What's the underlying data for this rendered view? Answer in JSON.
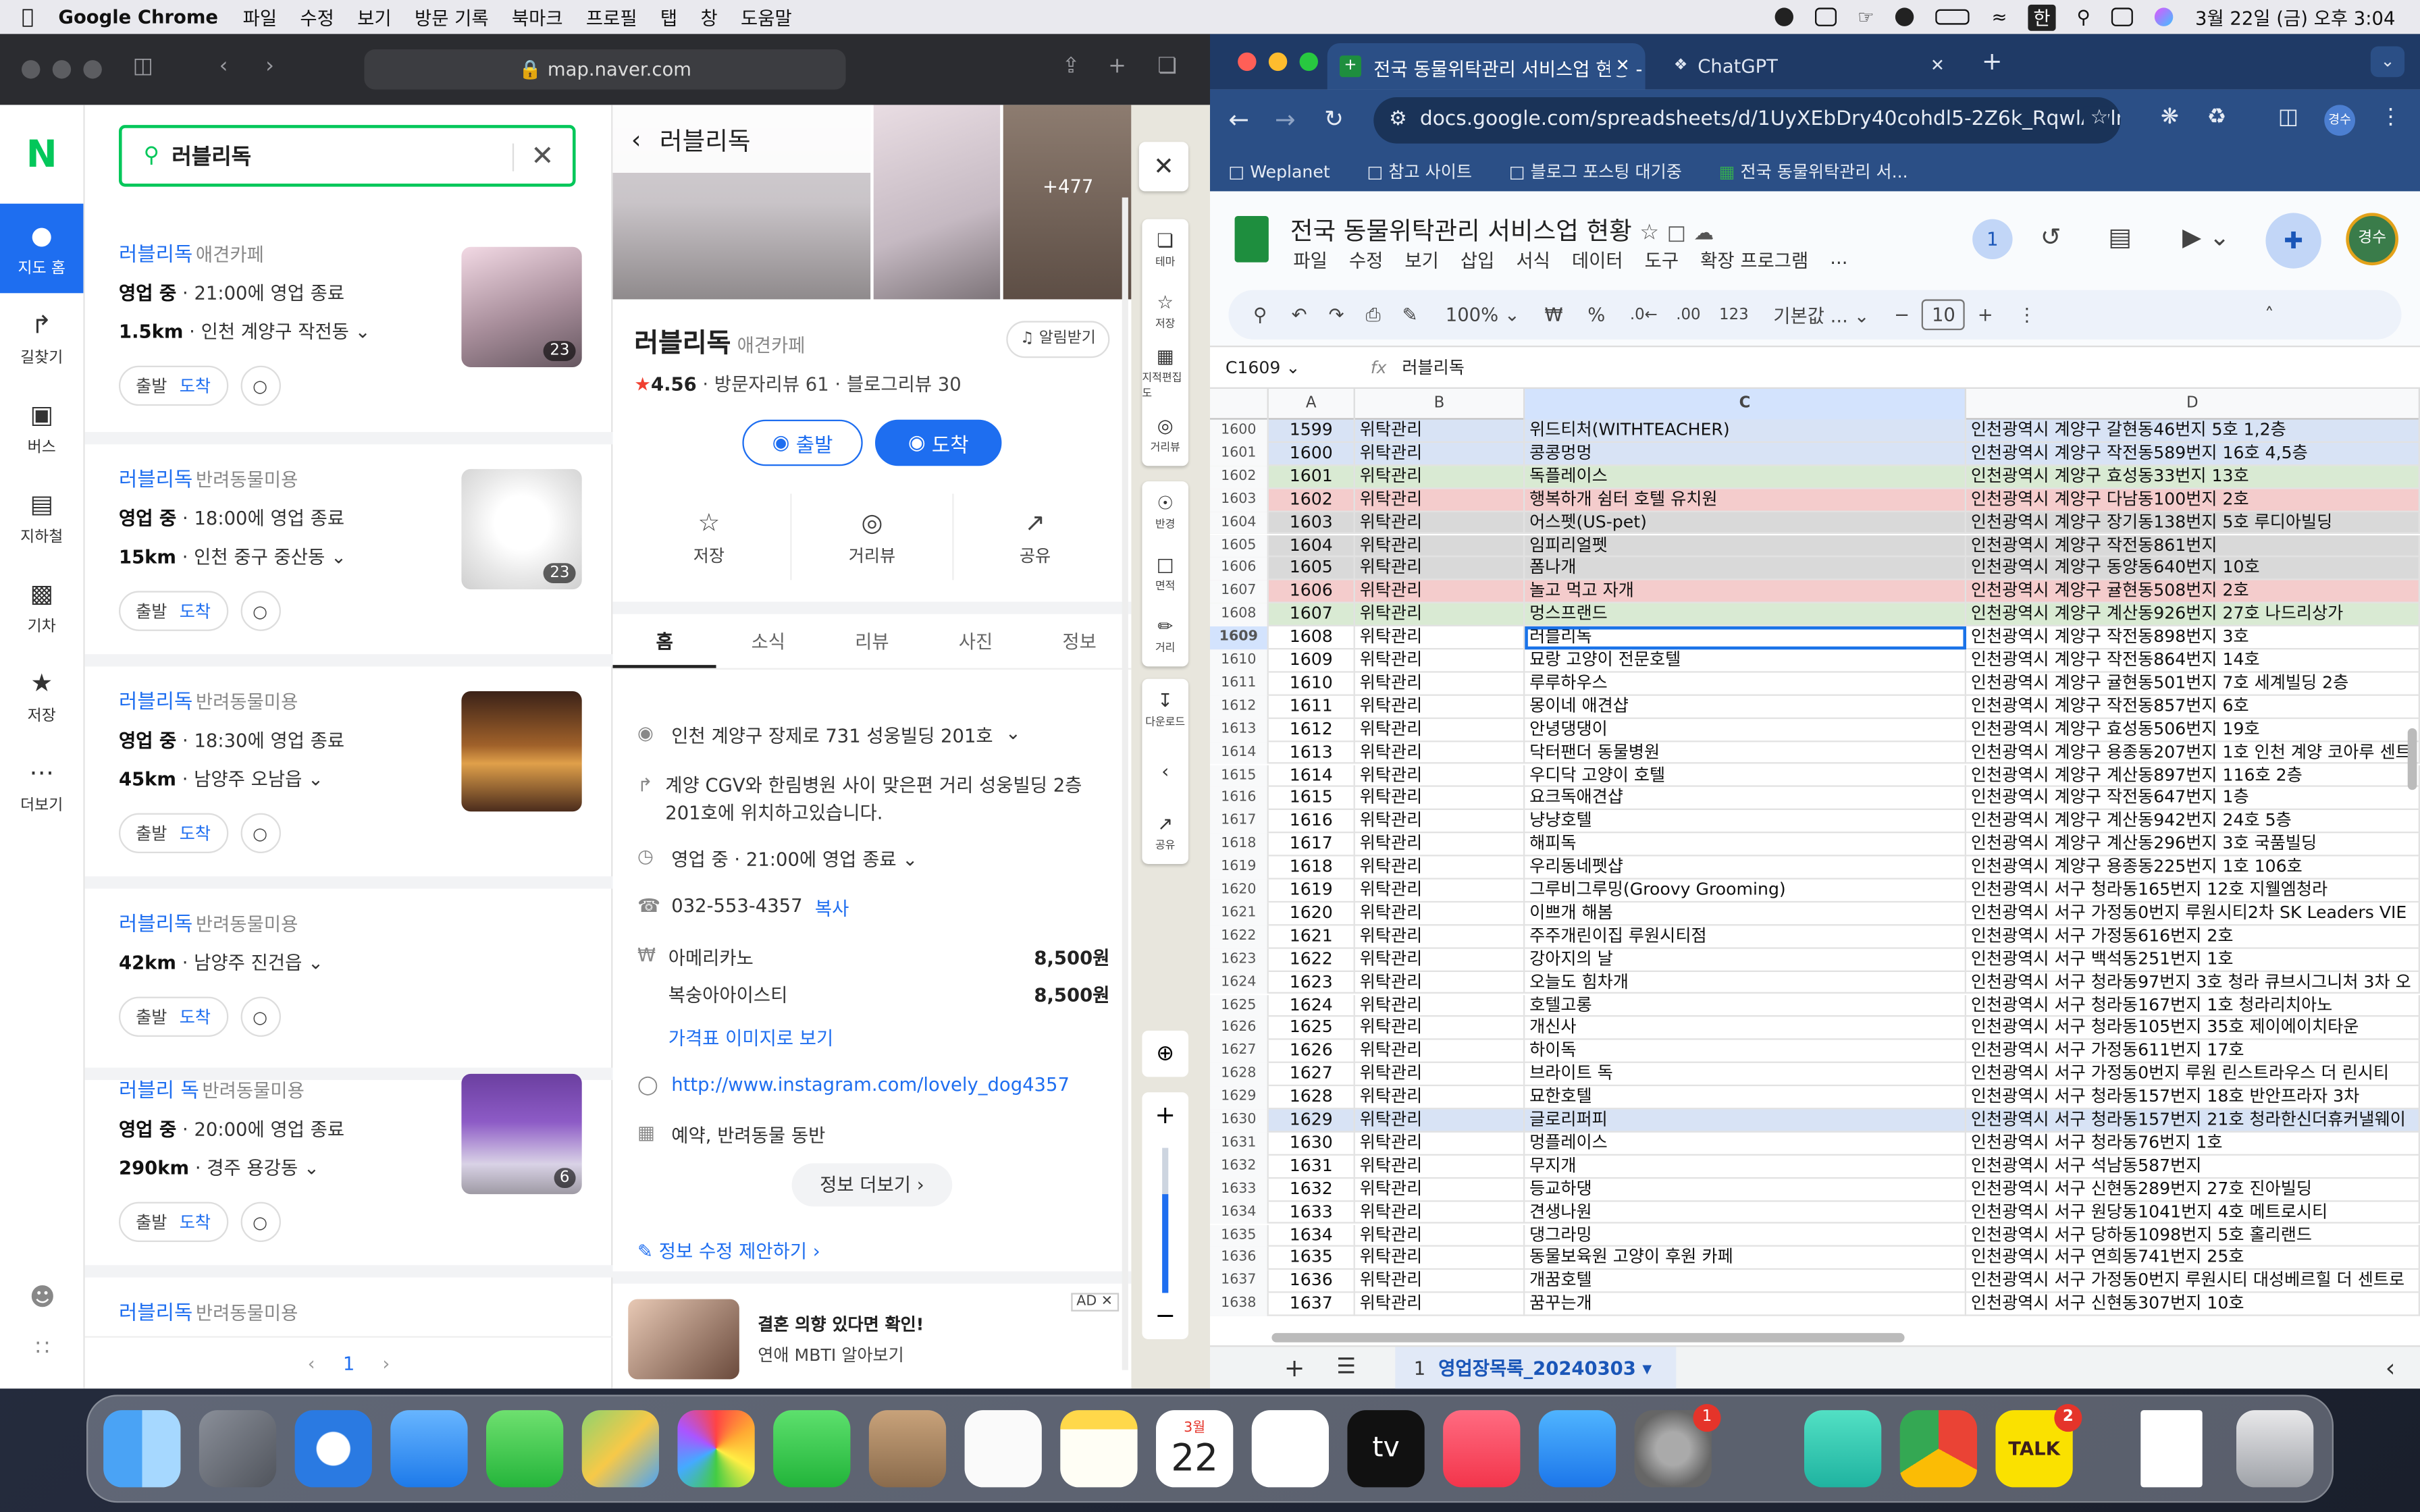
{
  "menubar": {
    "app_name": "Google Chrome",
    "items": [
      "파일",
      "수정",
      "보기",
      "방문 기록",
      "북마크",
      "프로필",
      "탭",
      "창",
      "도움말"
    ],
    "ime": "한",
    "datetime": "3월 22일 (금) 오후 3:04"
  },
  "naver": {
    "url": "map.naver.com",
    "logo": "N",
    "rail": [
      {
        "label": "지도 홈",
        "icon": "map-pin-icon"
      },
      {
        "label": "길찾기",
        "icon": "directions-icon"
      },
      {
        "label": "버스",
        "icon": "bus-icon"
      },
      {
        "label": "지하철",
        "icon": "subway-icon"
      },
      {
        "label": "기차",
        "icon": "train-icon"
      },
      {
        "label": "저장",
        "icon": "star-icon"
      },
      {
        "label": "더보기",
        "icon": "more-icon"
      }
    ],
    "search_value": "러블리독",
    "results": [
      {
        "name": "러블리독",
        "category": "애견카페",
        "status": "영업 중",
        "hours": "21:00에 영업 종료",
        "distance": "1.5km",
        "area": "인천 계양구 작전동",
        "photos": "23"
      },
      {
        "name": "러블리독",
        "category": "반려동물미용",
        "status": "영업 중",
        "hours": "18:00에 영업 종료",
        "distance": "15km",
        "area": "인천 중구 중산동",
        "photos": "23"
      },
      {
        "name": "러블리독",
        "category": "반려동물미용",
        "status": "영업 중",
        "hours": "18:30에 영업 종료",
        "distance": "45km",
        "area": "남양주 오남읍",
        "photos": ""
      },
      {
        "name": "러블리독",
        "category": "반려동물미용",
        "status": "",
        "hours": "",
        "distance": "42km",
        "area": "남양주 진건읍",
        "photos": ""
      },
      {
        "name": "러블리 독",
        "category": "반려동물미용",
        "status": "영업 중",
        "hours": "20:00에 영업 종료",
        "distance": "290km",
        "area": "경주 용강동",
        "photos": "6"
      },
      {
        "name": "러블리독",
        "category": "반려동물미용",
        "status": "",
        "hours": "",
        "distance": "",
        "area": "",
        "photos": ""
      }
    ],
    "btn_depart": "출발",
    "btn_arrive": "도착",
    "page": "1",
    "detail": {
      "header": "러블리독",
      "photo_count": "+477",
      "name": "러블리독",
      "category": "애견카페",
      "alarm": "알림받기",
      "rating": "4.56",
      "visitor_reviews": "방문자리뷰 61",
      "blog_reviews": "블로그리뷰 30",
      "btn_depart": "출발",
      "btn_arrive": "도착",
      "actions": [
        "저장",
        "거리뷰",
        "공유"
      ],
      "tabs": [
        "홈",
        "소식",
        "리뷰",
        "사진",
        "정보"
      ],
      "address": "인천 계양구 장제로 731 성웅빌딩 201호",
      "directions": "계양 CGV와 한림병원 사이 맞은편 거리 성웅빌딩 2층 201호에 위치하고있습니다.",
      "status": "영업 중",
      "hours": "21:00에 영업 종료",
      "phone": "032-553-4357",
      "copy": "복사",
      "menu": [
        {
          "item": "아메리카노",
          "price": "8,500원"
        },
        {
          "item": "복숭아아이스티",
          "price": "8,500원"
        }
      ],
      "price_image": "가격표 이미지로 보기",
      "website": "http://www.instagram.com/lovely_dog4357",
      "facilities": "예약, 반려동물 동반",
      "more_info": "정보 더보기",
      "suggest_edit": "정보 수정 제안하기",
      "ad_tag": "AD",
      "ad_line1": "결혼 의향 있다면 확인!",
      "ad_line2": "연애 MBTI 알아보기"
    },
    "map_tools": [
      "테마",
      "저장",
      "지적편집도",
      "거리뷰",
      "반경",
      "면적",
      "거리",
      "다운로드",
      "공유"
    ]
  },
  "chrome": {
    "tab1": "전국 동물위탁관리 서비스업 현황 -",
    "tab2": "ChatGPT",
    "omnibox": "docs.google.com/spreadsheets/d/1UyXEbDry40cohdl5-2Z6k_RqwlAwlm...",
    "bookmarks": [
      "Weplanet",
      "참고 사이트",
      "블로그 포스팅 대기중",
      "전국 동물위탁관리 서..."
    ],
    "profile": "경수"
  },
  "sheet": {
    "title": "전국 동물위탁관리 서비스업 현황",
    "menu": [
      "파일",
      "수정",
      "보기",
      "삽입",
      "서식",
      "데이터",
      "도구",
      "확장 프로그램",
      "..."
    ],
    "zoom": "100%",
    "currency": "₩",
    "percent": "%",
    "format123": "123",
    "font": "기본값 ...",
    "font_size": "10",
    "cell_ref": "C1609",
    "formula": "러블리독",
    "columns": [
      "A",
      "B",
      "C",
      "D"
    ],
    "rows": [
      [
        "1600",
        "1599",
        "위탁관리",
        "위드티처(WITHTEACHER)",
        "인천광역시 계양구 갈현동46번지 5호 1,2층"
      ],
      [
        "1601",
        "1600",
        "위탁관리",
        "콩콩멍멍",
        "인천광역시 계양구 작전동589번지 16호 4,5층"
      ],
      [
        "1602",
        "1601",
        "위탁관리",
        "독플레이스",
        "인천광역시 계양구 효성동33번지 13호"
      ],
      [
        "1603",
        "1602",
        "위탁관리",
        "행복하개 쉼터 호텔 유치원",
        "인천광역시 계양구 다남동100번지 2호"
      ],
      [
        "1604",
        "1603",
        "위탁관리",
        "어스펫(US-pet)",
        "인천광역시 계양구 장기동138번지 5호 루디아빌딩"
      ],
      [
        "1605",
        "1604",
        "위탁관리",
        "임피리얼펫",
        "인천광역시 계양구 작전동861번지"
      ],
      [
        "1606",
        "1605",
        "위탁관리",
        "폼나개",
        "인천광역시 계양구 동양동640번지 10호"
      ],
      [
        "1607",
        "1606",
        "위탁관리",
        "놀고 먹고 자개",
        "인천광역시 계양구 귤현동508번지 2호"
      ],
      [
        "1608",
        "1607",
        "위탁관리",
        "멍스프랜드",
        "인천광역시 계양구 계산동926번지 27호 나드리상가"
      ],
      [
        "1609",
        "1608",
        "위탁관리",
        "러블리독",
        "인천광역시 계양구 작전동898번지 3호"
      ],
      [
        "1610",
        "1609",
        "위탁관리",
        "묘랑 고양이 전문호텔",
        "인천광역시 계양구 작전동864번지 14호"
      ],
      [
        "1611",
        "1610",
        "위탁관리",
        "루루하우스",
        "인천광역시 계양구 귤현동501번지 7호 세계빌딩 2층"
      ],
      [
        "1612",
        "1611",
        "위탁관리",
        "몽이네 애견샵",
        "인천광역시 계양구 작전동857번지 6호"
      ],
      [
        "1613",
        "1612",
        "위탁관리",
        "안녕댕댕이",
        "인천광역시 계양구 효성동506번지 19호"
      ],
      [
        "1614",
        "1613",
        "위탁관리",
        "닥터팬더 동물병원",
        "인천광역시 계양구 용종동207번지 1호 인천 계양 코아루 센트"
      ],
      [
        "1615",
        "1614",
        "위탁관리",
        "우디닥 고양이 호텔",
        "인천광역시 계양구 계산동897번지 116호 2층"
      ],
      [
        "1616",
        "1615",
        "위탁관리",
        "요크독애견샵",
        "인천광역시 계양구 작전동647번지 1층"
      ],
      [
        "1617",
        "1616",
        "위탁관리",
        "냥냥호텔",
        "인천광역시 계양구 계산동942번지 24호 5층"
      ],
      [
        "1618",
        "1617",
        "위탁관리",
        "해피독",
        "인천광역시 계양구 계산동296번지 3호 국품빌딩"
      ],
      [
        "1619",
        "1618",
        "위탁관리",
        "우리동네펫샵",
        "인천광역시 계양구 용종동225번지 1호 106호"
      ],
      [
        "1620",
        "1619",
        "위탁관리",
        "그루비그루밍(Groovy Grooming)",
        "인천광역시 서구 청라동165번지 12호 지웰엠청라"
      ],
      [
        "1621",
        "1620",
        "위탁관리",
        "이쁘개 해봄",
        "인천광역시 서구 가정동0번지 루원시티2차 SK Leaders VIE"
      ],
      [
        "1622",
        "1621",
        "위탁관리",
        "주주개린이집 루원시티점",
        "인천광역시 서구 가정동616번지 2호"
      ],
      [
        "1623",
        "1622",
        "위탁관리",
        "강아지의 날",
        "인천광역시 서구 백석동251번지 1호"
      ],
      [
        "1624",
        "1623",
        "위탁관리",
        "오늘도 힘차개",
        "인천광역시 서구 청라동97번지 3호 청라 큐브시그니처 3차 오"
      ],
      [
        "1625",
        "1624",
        "위탁관리",
        "호텔고롱",
        "인천광역시 서구 청라동167번지 1호 청라리치아노"
      ],
      [
        "1626",
        "1625",
        "위탁관리",
        "개신사",
        "인천광역시 서구 청라동105번지 35호 제이에이치타운"
      ],
      [
        "1627",
        "1626",
        "위탁관리",
        "하이독",
        "인천광역시 서구 가정동611번지 17호"
      ],
      [
        "1628",
        "1627",
        "위탁관리",
        "브라이트 독",
        "인천광역시 서구 가정동0번지 루원 린스트라우스 더 린시티"
      ],
      [
        "1629",
        "1628",
        "위탁관리",
        "묘한호텔",
        "인천광역시 서구 청라동157번지 18호 반안프라자 3차"
      ],
      [
        "1630",
        "1629",
        "위탁관리",
        "글로리퍼피",
        "인천광역시 서구 청라동157번지 21호 청라한신더휴커낼웨이"
      ],
      [
        "1631",
        "1630",
        "위탁관리",
        "멍플레이스",
        "인천광역시 서구 청라동76번지 1호"
      ],
      [
        "1632",
        "1631",
        "위탁관리",
        "무지개",
        "인천광역시 서구 석남동587번지"
      ],
      [
        "1633",
        "1632",
        "위탁관리",
        "등교하댕",
        "인천광역시 서구 신현동289번지 27호 진아빌딩"
      ],
      [
        "1634",
        "1633",
        "위탁관리",
        "견생나원",
        "인천광역시 서구 원당동1041번지 4호 메트로시티"
      ],
      [
        "1635",
        "1634",
        "위탁관리",
        "댕그라밍",
        "인천광역시 서구 당하동1098번지 5호 홀리랜드"
      ],
      [
        "1636",
        "1635",
        "위탁관리",
        "동물보육원 고양이 후원 카페",
        "인천광역시 서구 연희동741번지 25호"
      ],
      [
        "1637",
        "1636",
        "위탁관리",
        "개꿈호텔",
        "인천광역시 서구 가정동0번지 루원시티 대성베르힐 더 센트로"
      ],
      [
        "1638",
        "1637",
        "위탁관리",
        "꿈꾸는개",
        "인천광역시 서구 신현동307번지 10호"
      ]
    ],
    "row_colors": {
      "1600": "#d8e3f5",
      "1601": "#d8e3f5",
      "1602": "#d9ead3",
      "1603": "#f4cccc",
      "1604": "#d9d9d9",
      "1605": "#d9d9d9",
      "1606": "#d9d9d9",
      "1607": "#f4cccc",
      "1608": "#d9ead3",
      "1630": "#d8e3f5"
    },
    "sheet_tab": "영업장목록_20240303",
    "sheet_tab_num": "1",
    "presence": "1"
  },
  "dock": {
    "calendar_month": "3월",
    "calendar_day": "22",
    "settings_badge": "1",
    "kakao_badge": "2",
    "kakao_label": "TALK",
    "tv_label": "tv"
  }
}
